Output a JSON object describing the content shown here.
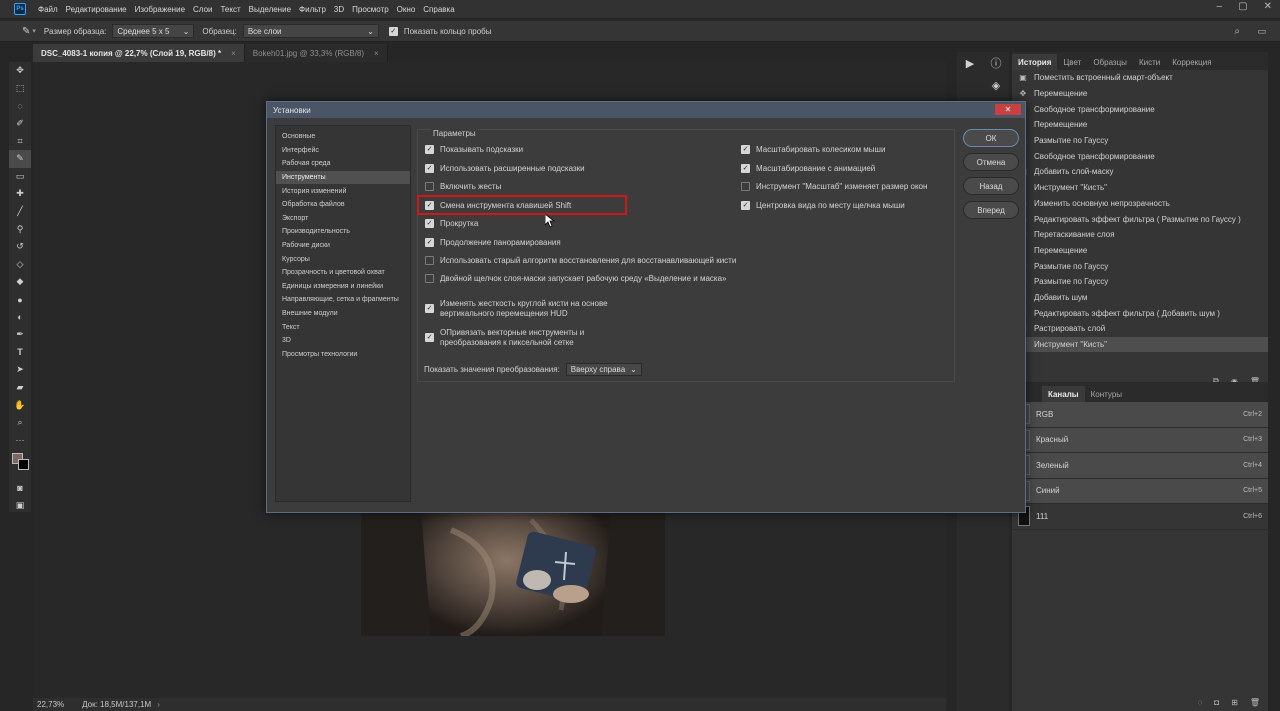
{
  "menubar": {
    "items": [
      "Файл",
      "Редактирование",
      "Изображение",
      "Слои",
      "Текст",
      "Выделение",
      "Фильтр",
      "3D",
      "Просмотр",
      "Окно",
      "Справка"
    ]
  },
  "optbar": {
    "sample_size_label": "Размер образца:",
    "sample_size_value": "Среднее 5 x 5",
    "sample_label": "Образец:",
    "sample_value": "Все слои",
    "show_ring_label": "Показать кольцо пробы",
    "show_ring_checked": true
  },
  "tabs": [
    {
      "label": "DSC_4083-1 копия @ 22,7% (Слой 19, RGB/8) *",
      "active": true
    },
    {
      "label": "Bokeh01.jpg @ 33,3% (RGB/8)",
      "active": false
    }
  ],
  "status": {
    "zoom": "22,73%",
    "doc": "Док: 18,5M/137,1M"
  },
  "history_panel": {
    "tabs": [
      "История",
      "Цвет",
      "Образцы",
      "Кисти",
      "Коррекция"
    ],
    "items": [
      {
        "icon": "smart-object",
        "label": "Поместить встроенный смарт-объект"
      },
      {
        "icon": "move",
        "label": "Перемещение"
      },
      {
        "icon": "transform",
        "label": "Свободное трансформирование"
      },
      {
        "icon": "move",
        "label": "Перемещение"
      },
      {
        "icon": "filter",
        "label": "Размытие по Гауссу"
      },
      {
        "icon": "transform",
        "label": "Свободное трансформирование"
      },
      {
        "icon": "mask",
        "label": "Добавить слой-маску"
      },
      {
        "icon": "brush",
        "label": "Инструмент \"Кисть\""
      },
      {
        "icon": "opacity",
        "label": "Изменить основную непрозрачность"
      },
      {
        "icon": "filter",
        "label": "Редактировать эффект фильтра ( Размытие по Гауссу )"
      },
      {
        "icon": "drag",
        "label": "Перетаскивание слоя"
      },
      {
        "icon": "move",
        "label": "Перемещение"
      },
      {
        "icon": "filter",
        "label": "Размытие по Гауссу"
      },
      {
        "icon": "filter",
        "label": "Размытие по Гауссу"
      },
      {
        "icon": "filter",
        "label": "Добавить шум"
      },
      {
        "icon": "filter",
        "label": "Редактировать эффект фильтра ( Добавить шум )"
      },
      {
        "icon": "rasterize",
        "label": "Растрировать слой"
      },
      {
        "icon": "brush",
        "label": "Инструмент \"Кисть\""
      }
    ],
    "active_index": 17
  },
  "channels_panel": {
    "tabs": [
      "Каналы",
      "Контуры"
    ],
    "items": [
      {
        "name": "RGB",
        "shortcut": "Ctrl+2"
      },
      {
        "name": "Красный",
        "shortcut": "Ctrl+3"
      },
      {
        "name": "Зеленый",
        "shortcut": "Ctrl+4"
      },
      {
        "name": "Синий",
        "shortcut": "Ctrl+5"
      },
      {
        "name": "111",
        "shortcut": "Ctrl+6"
      }
    ]
  },
  "dialog": {
    "title": "Установки",
    "nav": [
      "Основные",
      "Интерфейс",
      "Рабочая среда",
      "Инструменты",
      "История изменений",
      "Обработка файлов",
      "Экспорт",
      "Производительность",
      "Рабочие диски",
      "Курсоры",
      "Прозрачность и цветовой охват",
      "Единицы измерения и линейки",
      "Направляющие, сетка и фрагменты",
      "Внешние модули",
      "Текст",
      "3D",
      "Просмотры технологии"
    ],
    "active_nav_index": 3,
    "section_title": "Параметры",
    "left_options": [
      {
        "label": "Показывать подсказки",
        "checked": true
      },
      {
        "label": "Использовать расширенные подсказки",
        "checked": true
      },
      {
        "label": "Включить жесты",
        "checked": false
      },
      {
        "label": "Смена инструмента клавишей Shift",
        "checked": true
      },
      {
        "label": "Прокрутка",
        "checked": true
      },
      {
        "label": "Продолжение панорамирования",
        "checked": true
      },
      {
        "label": "Использовать старый алгоритм восстановления для восстанавливающей кисти",
        "checked": false
      },
      {
        "label": "Двойной щелчок слоя-маски запускает рабочую среду «Выделение и маска»",
        "checked": false
      }
    ],
    "multi_options": [
      {
        "line1": "Изменять жесткость круглой кисти на основе",
        "line2": "вертикального перемещения HUD",
        "checked": true
      },
      {
        "line1": "ОПривязать векторные инструменты и",
        "line2": "преобразования к пиксельной сетке",
        "checked": true
      }
    ],
    "right_options": [
      {
        "label": "Масштабировать колесиком мыши",
        "checked": true
      },
      {
        "label": "Масштабирование с анимацией",
        "checked": true
      },
      {
        "label": "Инструмент \"Масштаб\" изменяет размер окон",
        "checked": false
      },
      {
        "label": "Центровка вида по месту щелчка мыши",
        "checked": true
      }
    ],
    "transform_label": "Показать значения преобразования:",
    "transform_value": "Вверху справа",
    "buttons": {
      "ok": "ОК",
      "cancel": "Отмена",
      "back": "Назад",
      "forward": "Вперед"
    }
  },
  "colors": {
    "highlight_border": "#d01818",
    "dialog_bg": "#3c3c3c",
    "panel_bg": "#353535"
  }
}
